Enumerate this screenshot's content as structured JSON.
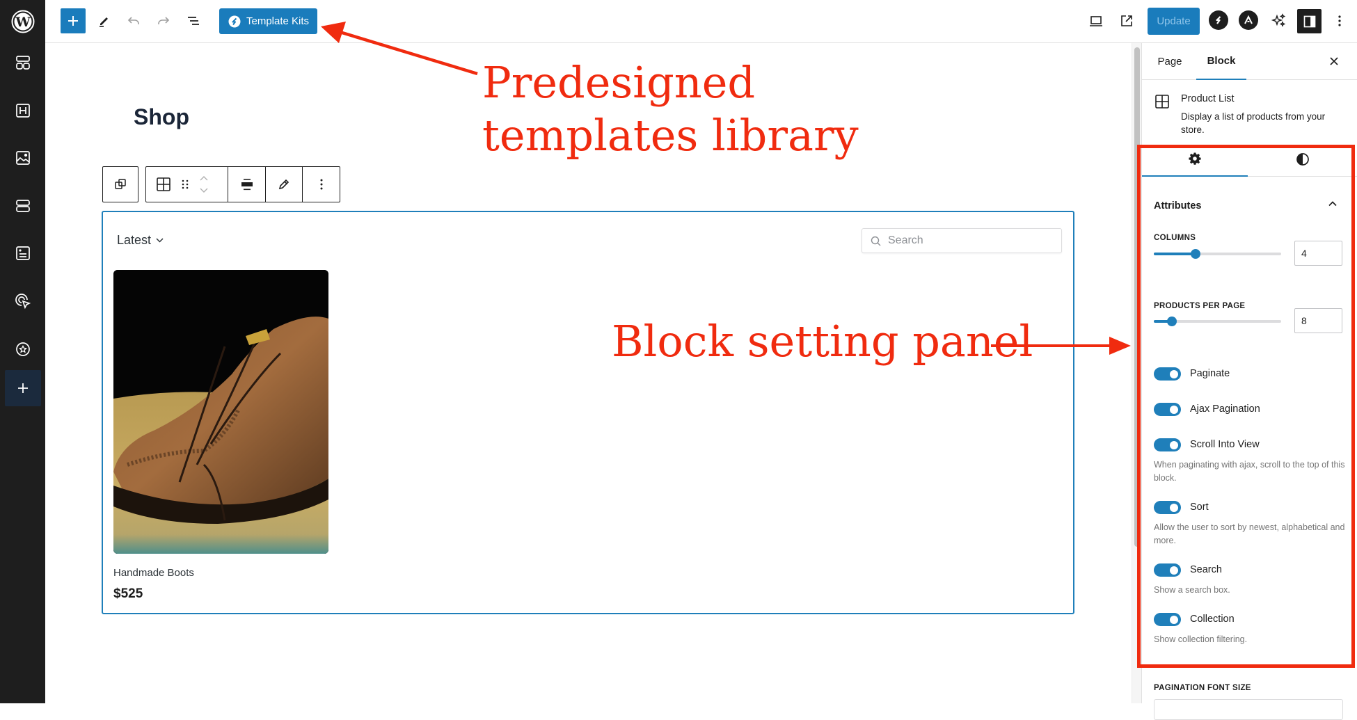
{
  "rail": {
    "items": [
      {
        "name": "patterns",
        "icon": "patterns-icon"
      },
      {
        "name": "heading",
        "icon": "heading-icon"
      },
      {
        "name": "image",
        "icon": "image-icon"
      },
      {
        "name": "sections",
        "icon": "sections-icon"
      },
      {
        "name": "form",
        "icon": "form-icon"
      },
      {
        "name": "interaction",
        "icon": "cursor-click-icon"
      },
      {
        "name": "favorites",
        "icon": "star-badge-icon"
      },
      {
        "name": "add",
        "icon": "plus-icon"
      }
    ]
  },
  "topbar": {
    "template_kits_label": "Template Kits",
    "update_label": "Update"
  },
  "canvas": {
    "page_title": "Shop",
    "sort": {
      "selected": "Latest"
    },
    "search": {
      "placeholder": "Search"
    },
    "products": [
      {
        "name": "Handmade Boots",
        "price": "$525"
      }
    ]
  },
  "sidebar": {
    "tabs": [
      {
        "label": "Page",
        "active": false
      },
      {
        "label": "Block",
        "active": true
      }
    ],
    "block": {
      "name": "Product List",
      "description": "Display a list of products from your store."
    },
    "panel_title": "Attributes",
    "columns": {
      "label": "COLUMNS",
      "value": "4",
      "slider_fraction": 0.33
    },
    "products_per_page": {
      "label": "PRODUCTS PER PAGE",
      "value": "8",
      "slider_fraction": 0.14
    },
    "toggles": [
      {
        "label": "Paginate",
        "on": true,
        "help": ""
      },
      {
        "label": "Ajax Pagination",
        "on": true,
        "help": ""
      },
      {
        "label": "Scroll Into View",
        "on": true,
        "help": "When paginating with ajax, scroll to the top of this block."
      },
      {
        "label": "Sort",
        "on": true,
        "help": "Allow the user to sort by newest, alphabetical and more."
      },
      {
        "label": "Search",
        "on": true,
        "help": "Show a search box."
      },
      {
        "label": "Collection",
        "on": true,
        "help": "Show collection filtering."
      }
    ],
    "pagination_font_size_label": "PAGINATION FONT SIZE"
  },
  "annotations": {
    "templates": {
      "line1": "Predesigned",
      "line2": "templates library"
    },
    "panel": "Block setting panel"
  },
  "colors": {
    "accent": "#1f7fba",
    "annotation": "#f02b0f",
    "rail": "#1e1e1e"
  }
}
